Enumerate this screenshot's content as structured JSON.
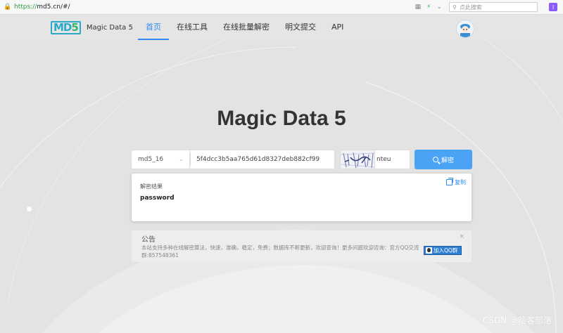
{
  "browser": {
    "url_scheme": "https://",
    "url_rest": "md5.cn/#/",
    "search_placeholder": "点此搜索",
    "extension_glyph": "I"
  },
  "nav": {
    "logo_mark": "MD",
    "logo_mark_num": "5",
    "logo_text": "Magic Data 5",
    "items": [
      {
        "label": "首页",
        "active": true
      },
      {
        "label": "在线工具",
        "active": false
      },
      {
        "label": "在线批量解密",
        "active": false
      },
      {
        "label": "明文提交",
        "active": false
      },
      {
        "label": "API",
        "active": false
      }
    ]
  },
  "hero": {
    "title": "Magic Data 5"
  },
  "form": {
    "hash_type": "md5_16",
    "hash_value": "5f4dcc3b5aa765d61d8327deb882cf99",
    "captcha_value": "nteu",
    "decrypt_label": "解密"
  },
  "result": {
    "label": "解密结果",
    "value": "password",
    "copy_label": "复制"
  },
  "notice": {
    "title": "公告",
    "body": "本站支持多种在线解密算法，快速，准确，稳定，免费；数据库不断更新，欢迎查询！更多问题欢迎咨询：官方QQ交流群:857548361",
    "close": "×",
    "qq_label": "加入QQ群"
  },
  "watermark": "CSDN @哈客部落",
  "colors": {
    "accent": "#2d8cf0",
    "button": "#4aa3f4",
    "background": "#e3e3e3"
  }
}
